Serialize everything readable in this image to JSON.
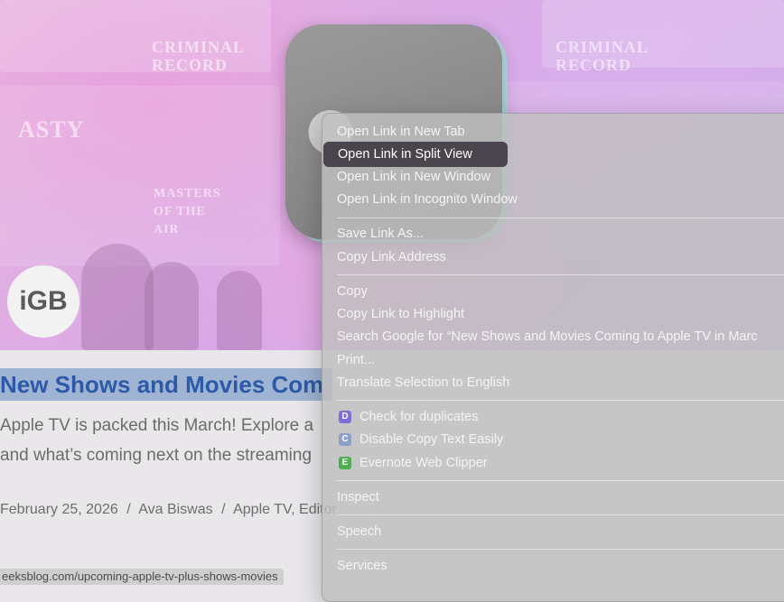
{
  "hero": {
    "poster_texts": [
      "CRIMINAL RECORD",
      "CRIMINAL RECORD",
      "ASTY",
      "MASTERS OF THE AIR"
    ],
    "badge_text": "iGB",
    "apple_logo_icon": "apple-logo-icon"
  },
  "article": {
    "title": "New Shows and Movies Com",
    "excerpt_line1": "Apple TV is packed this March! Explore a",
    "excerpt_line2": "and what’s coming next on the streaming",
    "date": "February 25, 2026",
    "author": "Ava Biswas",
    "category": "Apple TV, Editor",
    "separator": "/"
  },
  "status_bar": {
    "url": "eeksblog.com/upcoming-apple-tv-plus-shows-movies"
  },
  "context_menu": {
    "groups": [
      [
        {
          "label": "Open Link in New Tab"
        },
        {
          "label": "Open Link in Split View",
          "highlighted": true
        },
        {
          "label": "Open Link in New Window"
        },
        {
          "label": "Open Link in Incognito Window"
        }
      ],
      [
        {
          "label": "Save Link As..."
        },
        {
          "label": "Copy Link Address"
        }
      ],
      [
        {
          "label": "Copy"
        },
        {
          "label": "Copy Link to Highlight"
        },
        {
          "label": "Search Google for “New Shows and Movies Coming to Apple TV in Marc"
        },
        {
          "label": "Print..."
        },
        {
          "label": "Translate Selection to English"
        }
      ],
      [
        {
          "label": "Check for duplicates",
          "icon": "duplicates-extension-icon",
          "icon_color": "#7b6fd6",
          "icon_glyph": "D"
        },
        {
          "label": "Disable Copy Text Easily",
          "icon": "copy-text-extension-icon",
          "icon_color": "#8fa0c8",
          "icon_glyph": "C"
        },
        {
          "label": "Evernote Web Clipper",
          "icon": "evernote-icon",
          "icon_color": "#4caf50",
          "icon_glyph": "E"
        }
      ],
      [
        {
          "label": "Inspect"
        }
      ],
      [
        {
          "label": "Speech"
        }
      ],
      [
        {
          "label": "Services"
        }
      ]
    ],
    "colors": {
      "highlight": "#4a444c",
      "text": "#f4f4f4",
      "background": "#bebebe"
    }
  }
}
